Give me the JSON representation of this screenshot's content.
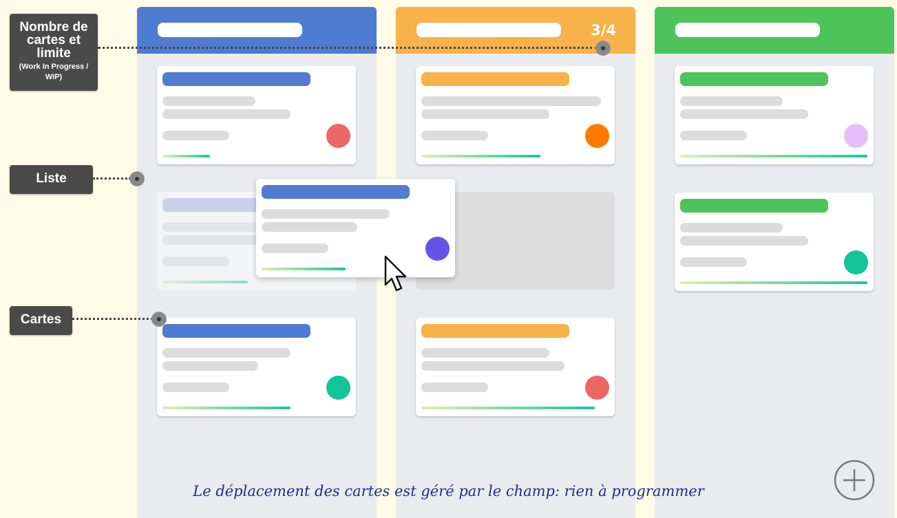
{
  "board": {
    "columns": [
      {
        "color": "#4f7bd0",
        "wip": ""
      },
      {
        "color": "#f7b24a",
        "wip": "3/4"
      },
      {
        "color": "#4cc45a",
        "wip": ""
      }
    ]
  },
  "annotations": {
    "wip_label": "Nombre de cartes et limite",
    "wip_sublabel": "(Work In Progress / WIP)",
    "list_label": "Liste",
    "cards_label": "Cartes"
  },
  "cards": [
    {
      "column": "blue",
      "avatar": "#ec6666",
      "progress": 0.25
    },
    {
      "column": "blue",
      "avatar": "#ec6666",
      "progress": 0.45,
      "state": "ghost"
    },
    {
      "column": "blue",
      "avatar": "#12c497",
      "progress": 0.68
    },
    {
      "column": "blue",
      "avatar": "#6654e8",
      "progress": 0.45,
      "state": "dragging"
    },
    {
      "column": "orange",
      "avatar": "#ff7a00",
      "progress": 0.64
    },
    {
      "column": "orange",
      "avatar": "#ec6666",
      "progress": 0.93
    },
    {
      "column": "green",
      "avatar": "#e7bdf7",
      "progress": 0.98
    },
    {
      "column": "green",
      "avatar": "#12c497",
      "progress": 0.98
    }
  ],
  "icons": [
    "cursor-icon",
    "add-icon"
  ],
  "caption": "Le déplacement des cartes est géré par le champ: rien à programmer"
}
